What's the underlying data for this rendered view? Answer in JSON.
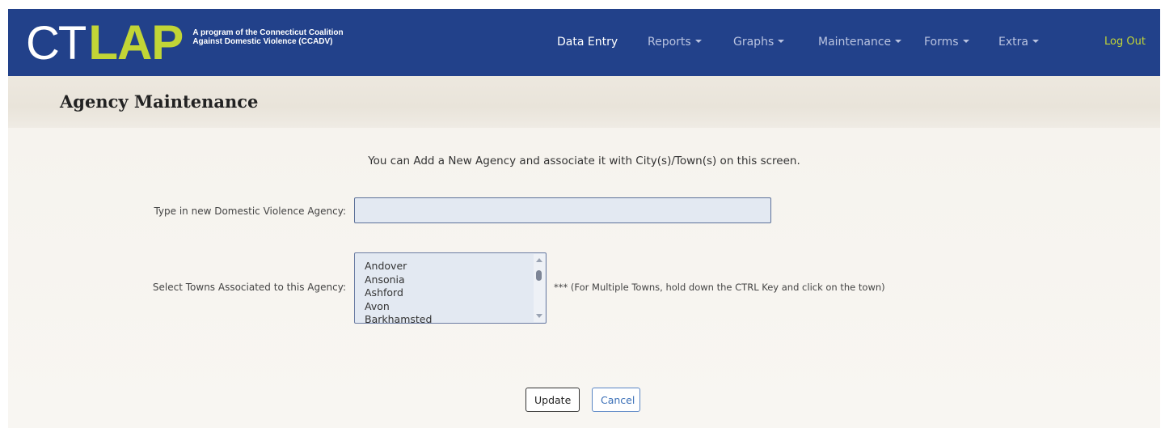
{
  "brand": {
    "logo_ct": "CT",
    "logo_lap": "LAP",
    "tagline_line1": "A program of the Connecticut Coalition",
    "tagline_line2": "Against Domestic Violence (CCADV)"
  },
  "nav": {
    "items": [
      {
        "label": "Data Entry",
        "dropdown": false
      },
      {
        "label": "Reports",
        "dropdown": true
      },
      {
        "label": "Graphs",
        "dropdown": true
      },
      {
        "label": "Maintenance",
        "dropdown": true
      },
      {
        "label": "Forms",
        "dropdown": true
      },
      {
        "label": "Extra",
        "dropdown": true
      }
    ],
    "logout": "Log Out"
  },
  "page": {
    "title": "Agency Maintenance",
    "intro": "You can Add a New Agency and associate it with City(s)/Town(s) on this screen."
  },
  "form": {
    "agency_label": "Type in new Domestic Violence Agency:",
    "agency_value": "",
    "towns_label": "Select Towns Associated to this Agency:",
    "towns": [
      "Andover",
      "Ansonia",
      "Ashford",
      "Avon",
      "Barkhamsted"
    ],
    "towns_hint": "*** (For Multiple Towns, hold down the CTRL Key and click on the town)",
    "update_label": "Update",
    "cancel_label": "Cancel"
  },
  "colors": {
    "navbar": "#22418a",
    "logo_accent": "#c2d536",
    "input_bg": "#e3e9f2",
    "cancel_border": "#5a86c5"
  }
}
